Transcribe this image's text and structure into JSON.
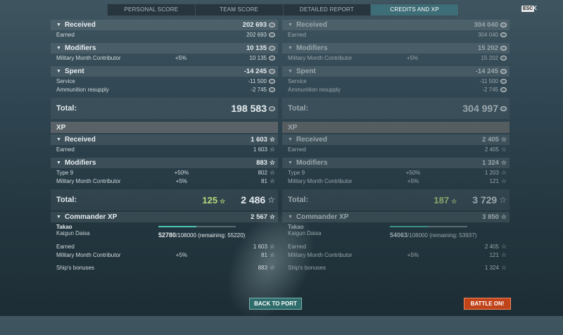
{
  "tabs": [
    {
      "label": "PERSONAL SCORE",
      "active": false
    },
    {
      "label": "TEAM SCORE",
      "active": false
    },
    {
      "label": "DETAILED REPORT",
      "active": false
    },
    {
      "label": "CREDITS AND XP",
      "active": true
    }
  ],
  "esc_label": "ESC",
  "close_glyph": "×",
  "left": {
    "received": {
      "label": "Received",
      "value": "202 693"
    },
    "earned": {
      "label": "Earned",
      "value": "202 693"
    },
    "modifiers": {
      "label": "Modifiers",
      "value": "10 135"
    },
    "mmc": {
      "label": "Military Month Contributor",
      "pct": "+5%",
      "value": "10 135"
    },
    "spent": {
      "label": "Spent",
      "value": "-14 245"
    },
    "service": {
      "label": "Service",
      "value": "-11 500"
    },
    "ammo": {
      "label": "Ammunition resupply",
      "value": "-2 745"
    },
    "total": {
      "label": "Total:",
      "value": "198 583"
    },
    "xp_title": "XP",
    "xp_received": {
      "label": "Received",
      "value": "1 603"
    },
    "xp_earned": {
      "label": "Earned",
      "value": "1 603"
    },
    "xp_modifiers": {
      "label": "Modifiers",
      "value": "883"
    },
    "type9": {
      "label": "Type 9",
      "pct": "+50%",
      "value": "802"
    },
    "xp_mmc": {
      "label": "Military Month Contributor",
      "pct": "+5%",
      "value": "81"
    },
    "xp_total": {
      "label": "Total:",
      "free": "125",
      "value": "2 486"
    },
    "commander_xp": {
      "label": "Commander XP",
      "value": "2 567"
    },
    "commander": {
      "name": "Takao",
      "rank": "Kaigun Daisa",
      "current": "52780",
      "max": "/108000",
      "remaining": "(remaining: 55220)",
      "progress": 0.489
    },
    "cmd_earned": {
      "label": "Earned",
      "value": "1 603"
    },
    "cmd_mmc": {
      "label": "Military Month Contributor",
      "pct": "+5%",
      "value": "81"
    },
    "ship_bonus": {
      "label": "Ship's bonuses",
      "value": "883"
    }
  },
  "right": {
    "received": {
      "label": "Received",
      "value": "304 040"
    },
    "earned": {
      "label": "Earned",
      "value": "304 040"
    },
    "modifiers": {
      "label": "Modifiers",
      "value": "15 202"
    },
    "mmc": {
      "label": "Military Month Contributor",
      "pct": "+5%",
      "value": "15 202"
    },
    "spent": {
      "label": "Spent",
      "value": "-14 245"
    },
    "service": {
      "label": "Service",
      "value": "-11 500"
    },
    "ammo": {
      "label": "Ammunition resupply",
      "value": "-2 745"
    },
    "total": {
      "label": "Total:",
      "value": "304 997"
    },
    "xp_title": "XP",
    "xp_received": {
      "label": "Received",
      "value": "2 405"
    },
    "xp_earned": {
      "label": "Earned",
      "value": "2 405"
    },
    "xp_modifiers": {
      "label": "Modifiers",
      "value": "1 324"
    },
    "type9": {
      "label": "Type 9",
      "pct": "+50%",
      "value": "1 203"
    },
    "xp_mmc": {
      "label": "Military Month Contributor",
      "pct": "+5%",
      "value": "121"
    },
    "xp_total": {
      "label": "Total:",
      "free": "187",
      "value": "3 729"
    },
    "commander_xp": {
      "label": "Commander XP",
      "value": "3 850"
    },
    "commander": {
      "name": "Takao",
      "rank": "Kaigun Daisa",
      "current": "54063",
      "max": "/108000",
      "remaining": "(remaining: 53937)",
      "progress": 0.501
    },
    "cmd_earned": {
      "label": "Earned",
      "value": "2 405"
    },
    "cmd_mmc": {
      "label": "Military Month Contributor",
      "pct": "+5%",
      "value": "121"
    },
    "ship_bonus": {
      "label": "Ship's bonuses",
      "value": "1 324"
    }
  },
  "buttons": {
    "back": "BACK TO PORT",
    "battle": "BATTLE ON!"
  },
  "colors": {
    "active_tab": "#3d6d77",
    "accent_green": "#b6d97a",
    "progress": "#4fc6b8",
    "battle_button": "#c0431a",
    "back_button": "#2f6d6c"
  }
}
